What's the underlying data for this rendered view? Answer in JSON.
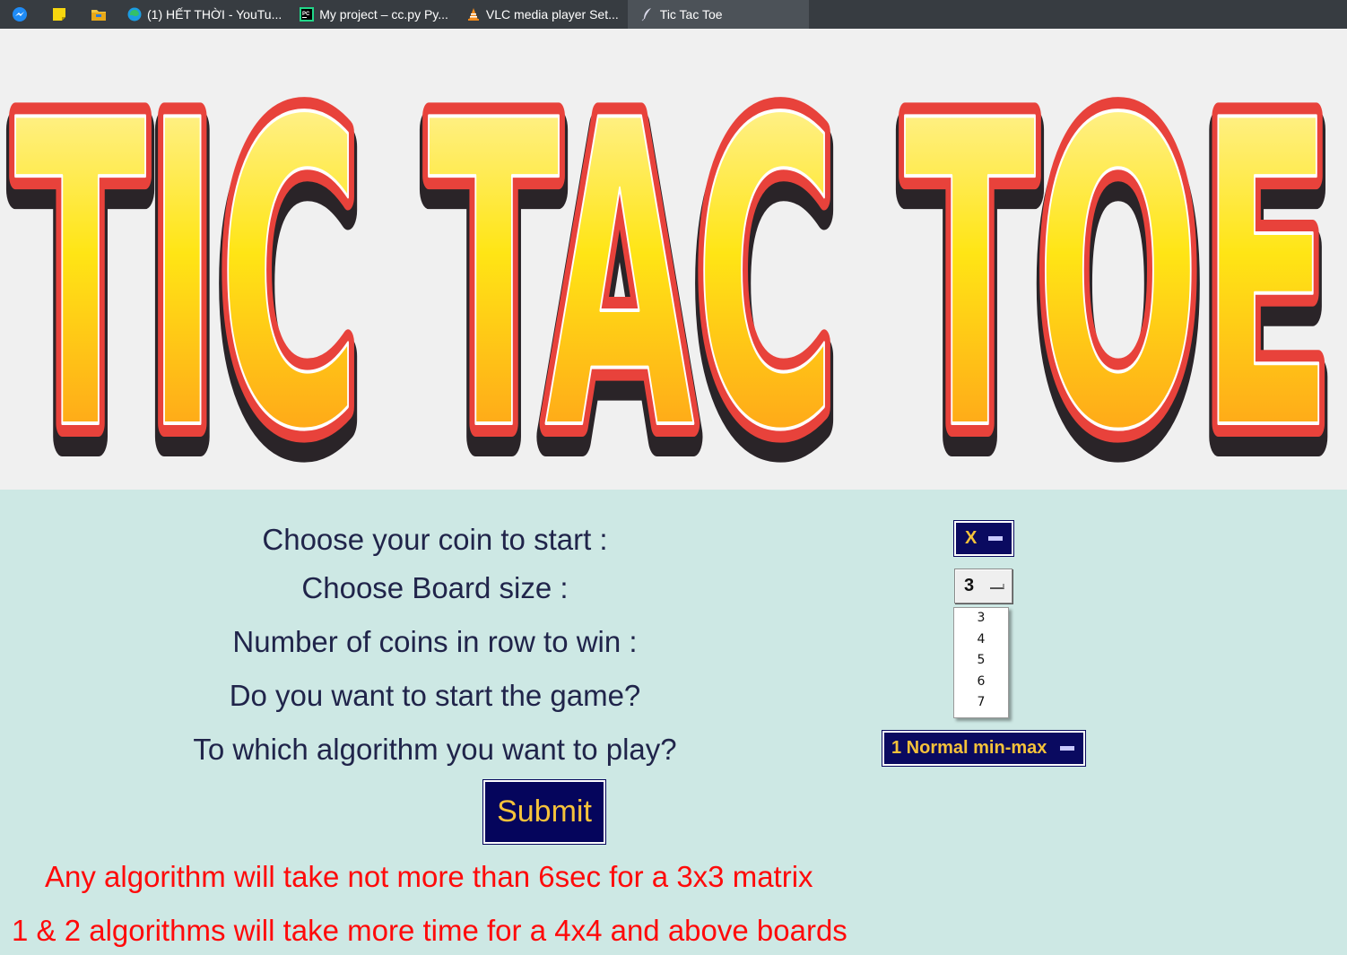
{
  "taskbar": {
    "icons": [
      "messenger-icon",
      "sticky-notes-icon",
      "file-explorer-icon"
    ],
    "tabs": [
      {
        "label": "(1) HẾT THỜI - YouTu...",
        "icon": "edge-icon"
      },
      {
        "label": "My project – cc.py Py...",
        "icon": "pycharm-icon"
      },
      {
        "label": "VLC media player Set...",
        "icon": "vlc-icon"
      },
      {
        "label": "Tic Tac Toe",
        "icon": "feather-icon",
        "active": true
      }
    ]
  },
  "banner": {
    "logo_text": "TIC TAC TOE"
  },
  "form": {
    "coin_label": "Choose your coin to start :",
    "coin_value": "X",
    "board_label": "Choose Board size :",
    "board_value": "3",
    "board_options": [
      "3",
      "4",
      "5",
      "6",
      "7"
    ],
    "win_label": "Number of coins in row to win :",
    "start_label": "Do you want to start the game?",
    "algo_label": "To which algorithm you want to play?",
    "algo_value": "1 Normal min-max",
    "submit_label": "Submit"
  },
  "notes": [
    "Any algorithm will take not more than 6sec for a 3x3 matrix",
    "1 & 2 algorithms will take more time for a 4x4 and above boards"
  ],
  "colors": {
    "form_background": "#cde8e4",
    "banner_background": "#f0f0f0",
    "label_text": "#20244a",
    "button_dark": "#0a0a60",
    "button_text": "#f5c23a",
    "note_text": "#ff0a0a"
  }
}
